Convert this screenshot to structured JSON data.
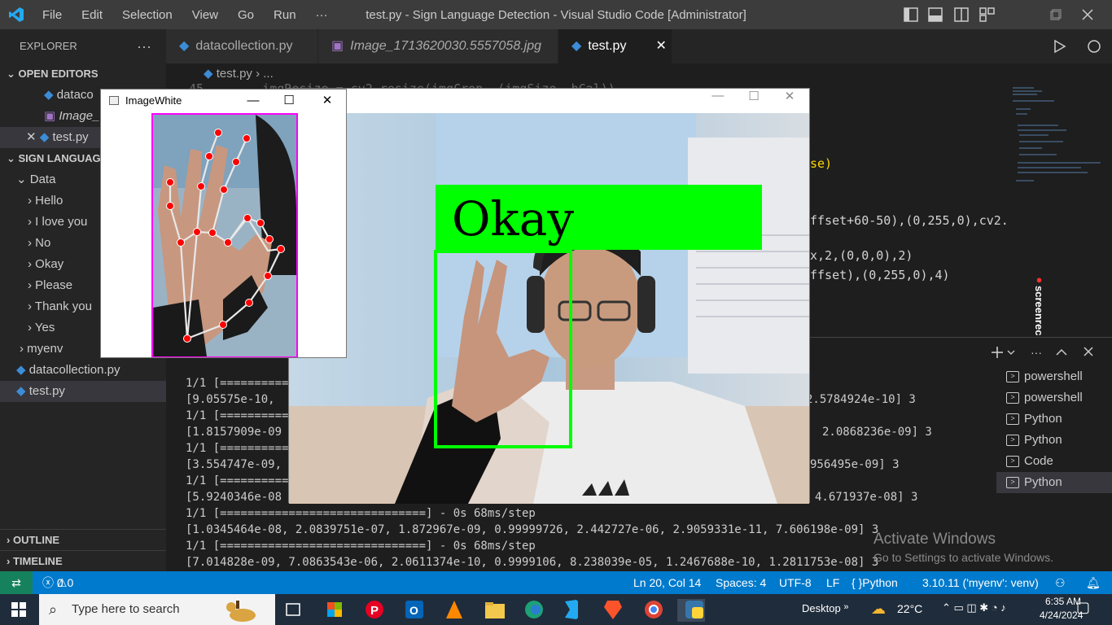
{
  "window": {
    "title": "test.py - Sign Language Detection - Visual Studio Code [Administrator]",
    "menu": [
      "File",
      "Edit",
      "Selection",
      "View",
      "Go",
      "Run",
      "···"
    ]
  },
  "sidebar": {
    "header": "EXPLORER",
    "open_editors_label": "OPEN EDITORS",
    "open_editors": [
      "dataco",
      "Image_",
      "test.py"
    ],
    "project_label": "SIGN LANGUAGE",
    "folders": {
      "data": "Data",
      "children": [
        "Hello",
        "I love you",
        "No",
        "Okay",
        "Please",
        "Thank you",
        "Yes"
      ],
      "myenv": "myenv"
    },
    "files": [
      "datacollection.py",
      "test.py"
    ],
    "outline": "OUTLINE",
    "timeline": "TIMELINE"
  },
  "tabs": [
    {
      "label": "datacollection.py"
    },
    {
      "label": "Image_1713620030.5557058.jpg"
    },
    {
      "label": "test.py"
    }
  ],
  "breadcrumb": {
    "file": "test.py",
    "more": "..."
  },
  "code_fragments": {
    "line45": "45        imgResize = cv2.resize(imgCrop, (imgSize, hCal))",
    "frag1": "se)",
    "frag2": "ffset+60-50),(0,255,0),cv2.",
    "frag3": "x,2,(0,0,0),2)",
    "frag4": "ffset),(0,255,0),4)"
  },
  "terminal": {
    "lines": [
      "1/1 [==========",
      "[9.05575e-10,",
      "1/1 [==========",
      "[1.8157909e-09",
      "1/1 [==========",
      "[3.554747e-09,",
      "1/1 [==========",
      "[5.9240346e-08",
      "1/1 [==============================] - 0s 68ms/step",
      "[1.0345464e-08, 2.0839751e-07, 1.872967e-09, 0.99999726, 2.442727e-06, 2.9059331e-11, 7.606198e-09] 3",
      "1/1 [==============================] - 0s 68ms/step",
      "[7.014828e-09, 7.0863543e-06, 2.0611374e-10, 0.9999106, 8.238039e-05, 1.2467688e-10, 1.2811753e-08] 3"
    ],
    "right_fragments": [
      "2.5784924e-10] 3",
      "2.0868236e-09] 3",
      "956495e-09] 3",
      "4.671937e-08] 3"
    ],
    "sessions": [
      "powershell",
      "powershell",
      "Python",
      "Python",
      "Code",
      "Python"
    ]
  },
  "watermark": {
    "line1": "Activate Windows",
    "line2": "Go to Settings to activate Windows."
  },
  "screenrec": "screenrec",
  "statusbar": {
    "errors": "0",
    "warnings": "0",
    "position": "Ln 20, Col 14",
    "spaces": "Spaces: 4",
    "encoding": "UTF-8",
    "eol": "LF",
    "language": "Python",
    "interpreter": "3.10.11 ('myenv': venv)"
  },
  "imgwhite": {
    "title": "ImageWhite"
  },
  "camera": {
    "prediction": "Okay"
  },
  "taskbar": {
    "search_placeholder": "Type here to search",
    "desktop": "Desktop",
    "weather": "22°C",
    "time": "6:35 AM",
    "date": "4/24/2024"
  },
  "colors": {
    "accent": "#007acc",
    "box": "#00ff00",
    "landmark": "#ff0000",
    "crop_border": "#ff00ff"
  }
}
